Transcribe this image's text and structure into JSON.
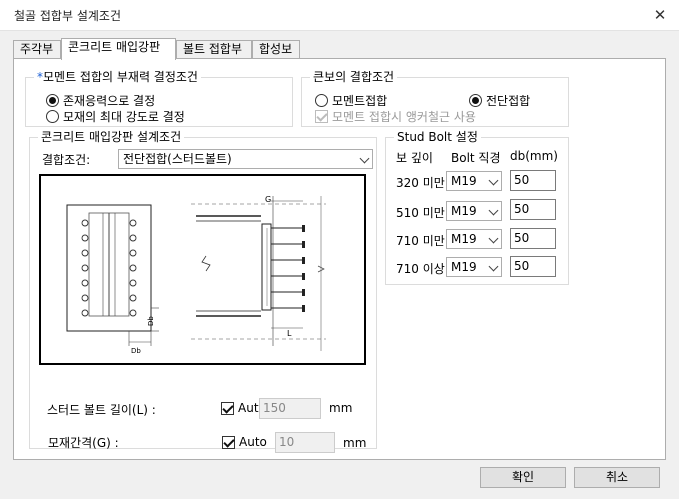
{
  "window": {
    "title": "철골 접합부 설계조건"
  },
  "tabs": [
    {
      "label": "주각부"
    },
    {
      "label": "콘크리트 매입강판"
    },
    {
      "label": "볼트 접합부"
    },
    {
      "label": "합성보"
    }
  ],
  "moment_group": {
    "star": "*",
    "title": "모멘트 접합의 부재력 결정조건",
    "options": [
      {
        "label": "존재응력으로 결정",
        "selected": true
      },
      {
        "label": "모재의 최대 강도로 결정",
        "selected": false
      }
    ]
  },
  "beam_group": {
    "title": "큰보의 결합조건",
    "options": [
      {
        "label": "모멘트접합",
        "selected": false
      },
      {
        "label": "전단접합",
        "selected": true
      }
    ],
    "anchor_label": "모멘트 접합시 앵커철근 사용",
    "anchor_checked": true
  },
  "plate_group": {
    "title": "콘크리트 매입강판 설계조건",
    "connection_label": "결합조건:",
    "connection_value": "전단접합(스터드볼트)",
    "drawing_labels": {
      "g": "G",
      "l": "L",
      "db": "Db",
      "db2": "Db"
    },
    "gap": {
      "label": "모재간격(G) :",
      "auto_label": "Auto",
      "auto": true,
      "value": "10",
      "unit": "mm"
    },
    "length": {
      "label": "스터드 볼트 길이(L) :",
      "auto_label": "Auto",
      "auto": true,
      "value": "150",
      "unit": "mm"
    }
  },
  "stud_group": {
    "title": "Stud Bolt 설정",
    "headers": [
      "보 깊이",
      "Bolt 직경",
      "db(mm)"
    ],
    "rows": [
      {
        "depth": "320 미만",
        "bolt": "M19",
        "db": "50"
      },
      {
        "depth": "510 미만",
        "bolt": "M19",
        "db": "50"
      },
      {
        "depth": "710 미만",
        "bolt": "M19",
        "db": "50"
      },
      {
        "depth": "710 이상",
        "bolt": "M19",
        "db": "50"
      }
    ]
  },
  "footer": {
    "ok_label": "확인",
    "cancel_label": "취소"
  },
  "icons": {
    "close": "close-icon"
  }
}
